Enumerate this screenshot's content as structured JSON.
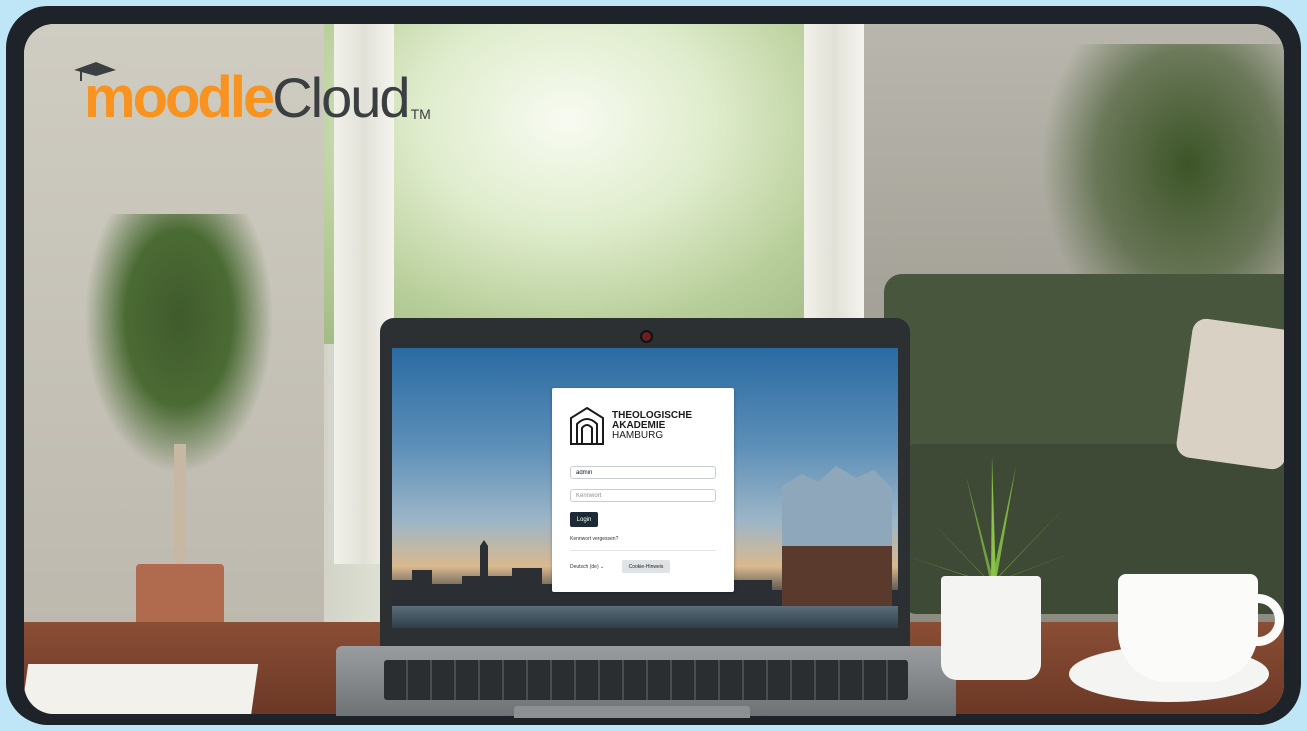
{
  "logo": {
    "word_moodle": "moodle",
    "word_cloud": "Cloud",
    "trademark": "TM",
    "accent_color": "#f7931e",
    "text_color": "#3c3f41",
    "icon": "graduation-cap-icon"
  },
  "login": {
    "brand_line1": "THEOLOGISCHE",
    "brand_line2": "AKADEMIE",
    "brand_line3": "HAMBURG",
    "brand_icon": "arch-gate-icon",
    "username_value": "admin",
    "password_placeholder": "Kennwort",
    "login_button": "Login",
    "forgot_password": "Kennwort vergessen?",
    "language_select": "Deutsch (de) ⌄",
    "cookie_button": "Cookie-Hinweis",
    "button_color": "#1c2a36"
  }
}
